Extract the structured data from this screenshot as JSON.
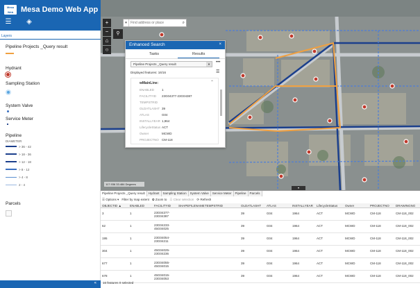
{
  "header": {
    "logo_text": "Mesa Web",
    "title": "Mesa Demo Web App",
    "icon_list": "list-icon",
    "icon_layers": "layers-icon"
  },
  "legend": {
    "tab_label": "Layers",
    "items": [
      {
        "title": "Pipeline Projects _Query result",
        "color": "#f0a040"
      },
      {
        "title": "Hydrant",
        "color": "#c0392b"
      },
      {
        "title": "Sampling Station",
        "color": "#5aa5e0"
      },
      {
        "title": "System Valve",
        "color": "#3a6fc0"
      },
      {
        "title": "Service Meter",
        "color": "#2b4b8f"
      },
      {
        "title": "Pipeline",
        "subtitle": "DIAMETER"
      },
      {
        "title": "Parcels"
      }
    ],
    "pipe_ranges": [
      "> 36 - 42",
      "> 18 - 36",
      "> 12 - 18",
      "> 8 - 12",
      "> 4 - 8",
      "2 - 4"
    ]
  },
  "collapse_arrow": "«",
  "search": {
    "placeholder": "Find address or place"
  },
  "enhanced_search": {
    "title": "Enhanced Search",
    "close": "×",
    "tabs": [
      "Tasks",
      "Results"
    ],
    "select_value": "Pipeline Projects _Query result",
    "more": "•••",
    "displayed": "Displayed features: 16/16",
    "layer_title": "wMainLine:",
    "fields": [
      {
        "k": "ENABLED",
        "v": "1"
      },
      {
        "k": "FACILITYID",
        "v": "23G04377-23G04387"
      },
      {
        "k": "TEMPSTRID",
        "v": ""
      },
      {
        "k": "OLDATLASHT",
        "v": "39"
      },
      {
        "k": "ATLAS",
        "v": "G04"
      },
      {
        "k": "INSTALLYEAR",
        "v": "1,964"
      },
      {
        "k": "LifecycleStatus",
        "v": "ACT"
      },
      {
        "k": "Owner",
        "v": "MCWD"
      },
      {
        "k": "PROJECTNO",
        "v": "CM-118"
      }
    ]
  },
  "scale_text": "117.936 33.484 Degrees",
  "table_toggle": "▾",
  "attr": {
    "tabs": [
      "Pipeline Projects _Query result",
      "Hydrant",
      "Sampling Station",
      "System Valve",
      "Service Meter",
      "Pipeline",
      "Parcels"
    ],
    "tools": [
      "☰ Options ▾",
      "Filter by map extent",
      "✿ Zoom to",
      "☲ Clear selection",
      "⟳ Refresh"
    ],
    "columns": [
      "OBJECTID ▲",
      "ENABLED",
      "FACILITYID",
      "SHAPEFILENAME",
      "TEMPSTRID",
      "OLDATLASHT",
      "ATLAS",
      "INSTALLYEAR",
      "LifecycleStatus",
      "Owner",
      "PROJECTNO",
      "DRAWINGNO"
    ],
    "rows": [
      [
        "3",
        "1",
        "23G04377-23G04387",
        "",
        "",
        "39",
        "G04",
        "1964",
        "ACT",
        "MCWD",
        "CM-118",
        "CM-118_002"
      ],
      [
        "62",
        "1",
        "23G04233-45G04025",
        "",
        "",
        "39",
        "G04",
        "1964",
        "ACT",
        "MCWD",
        "CM-118",
        "CM-118_002"
      ],
      [
        "195",
        "1",
        "23G04054-23G04211",
        "",
        "",
        "39",
        "G04",
        "1964",
        "ACT",
        "MCWD",
        "CM-118",
        "CM-118_002"
      ],
      [
        "304",
        "1",
        "45G04025-23G04236",
        "",
        "",
        "39",
        "G04",
        "1964",
        "ACT",
        "MCWD",
        "CM-118",
        "CM-118_002"
      ],
      [
        "677",
        "1",
        "23G04055-45G04015",
        "",
        "",
        "39",
        "G04",
        "1964",
        "ACT",
        "MCWD",
        "CM-118",
        "CM-118_002"
      ],
      [
        "678",
        "1",
        "45G04015-23G04053",
        "",
        "",
        "39",
        "G04",
        "1964",
        "ACT",
        "MCWD",
        "CM-118",
        "CM-118_002"
      ]
    ],
    "status": "16 features 0 selected"
  }
}
